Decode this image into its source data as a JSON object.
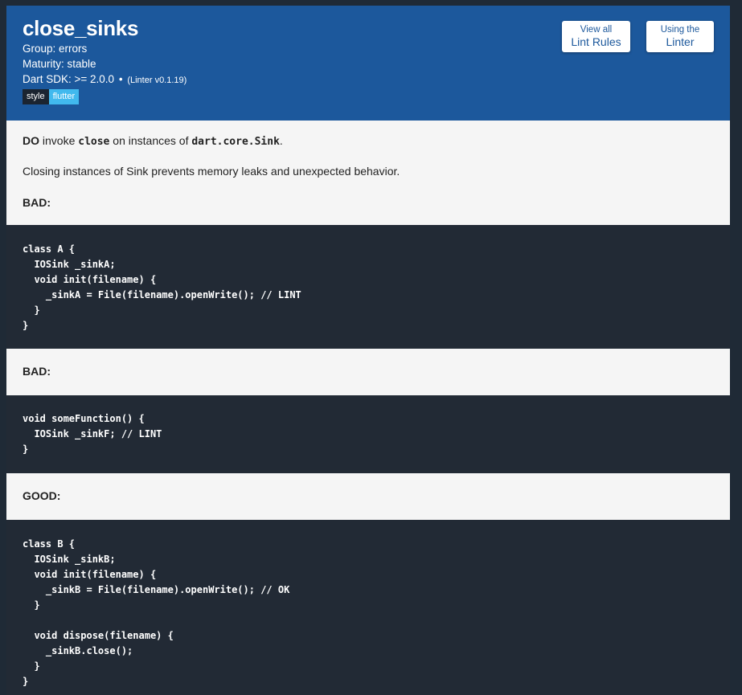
{
  "header": {
    "title": "close_sinks",
    "group": "Group: errors",
    "maturity": "Maturity: stable",
    "sdk": "Dart SDK: >= 2.0.0",
    "sdk_separator": "•",
    "linter_version": "(Linter v0.1.19)",
    "badges": {
      "style": "style",
      "flutter": "flutter"
    },
    "buttons": {
      "lint_rules_small": "View all",
      "lint_rules_big": "Lint Rules",
      "using_linter_small": "Using the",
      "using_linter_big": "Linter"
    }
  },
  "intro": {
    "do_word": "DO",
    "text_invoke": " invoke ",
    "code_close": "close",
    "text_on": " on instances of ",
    "code_sink": "dart.core.Sink",
    "text_period": ".",
    "description": "Closing instances of Sink prevents memory leaks and unexpected behavior."
  },
  "labels": {
    "bad1": "BAD:",
    "bad2": "BAD:",
    "good": "GOOD:"
  },
  "code": {
    "bad1": [
      "class A {",
      "  IOSink _sinkA;",
      "  void init(filename) {",
      "    _sinkA = File(filename).openWrite(); // LINT",
      "  }",
      "}"
    ],
    "bad2": [
      "void someFunction() {",
      "  IOSink _sinkF; // LINT",
      "}"
    ],
    "good": [
      "class B {",
      "  IOSink _sinkB;",
      "  void init(filename) {",
      "    _sinkB = File(filename).openWrite(); // OK",
      "  }",
      "",
      "  void dispose(filename) {",
      "    _sinkB.close();",
      "  }",
      "}"
    ]
  },
  "colors": {
    "header_bg": "#1c589c",
    "code_bg": "#222a35",
    "page_bg": "#f5f5f5",
    "badge_style": "#1b2430",
    "badge_flutter": "#41b9ee"
  }
}
